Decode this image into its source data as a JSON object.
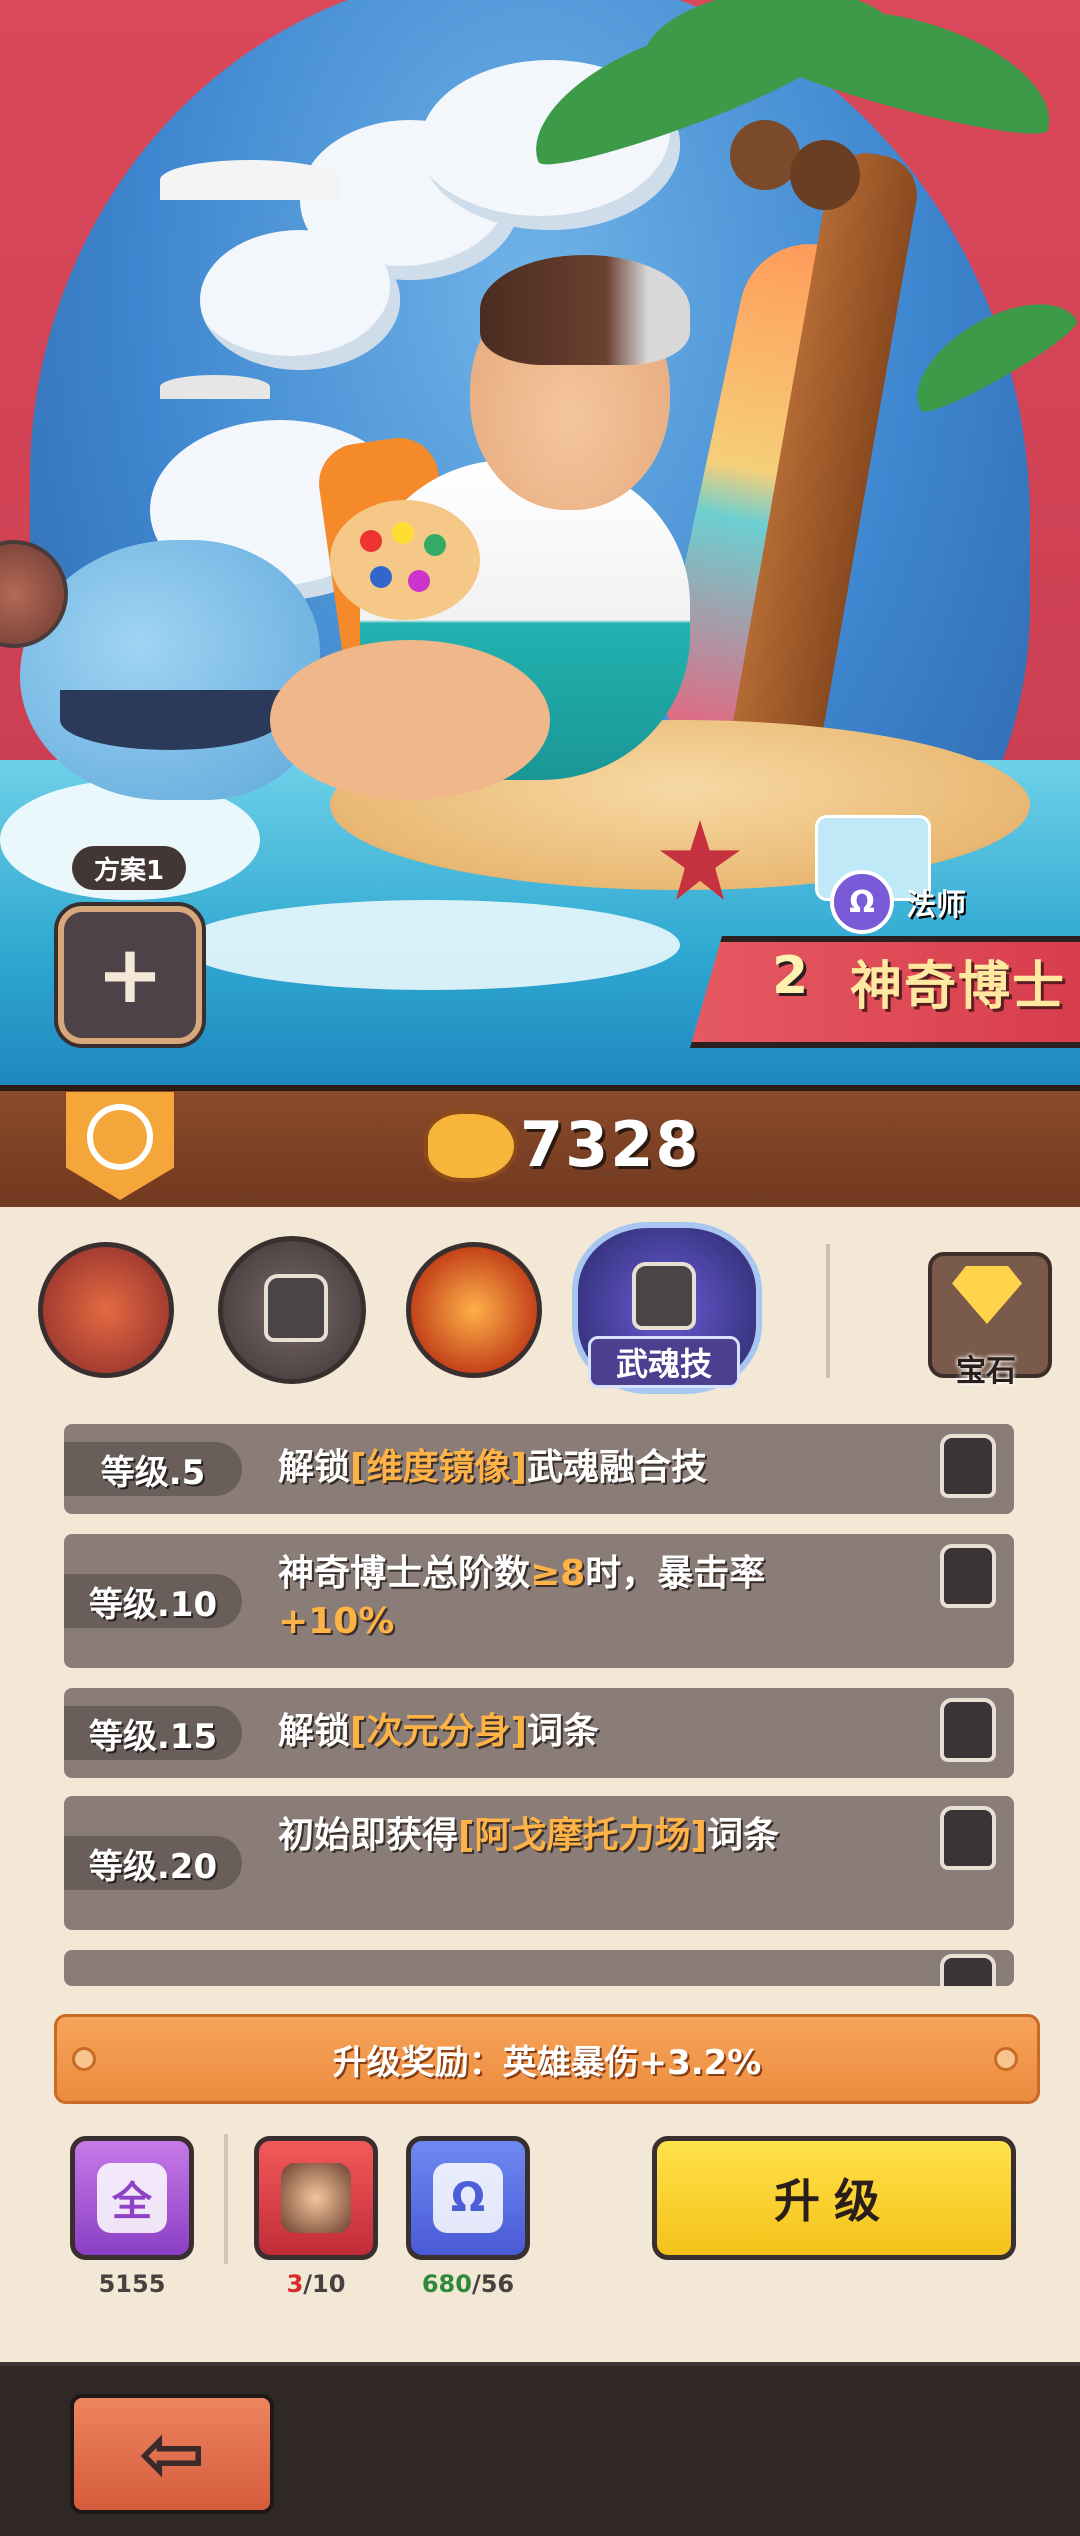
{
  "hero": {
    "plan_label": "方案1",
    "plan_add_icon": "+",
    "class_icon": "Ω",
    "class_name": "法师",
    "star_level": "2",
    "hero_name": "神奇博士"
  },
  "currency": {
    "amount": "7328"
  },
  "skills": {
    "wuhun_label": "武魂技",
    "gem_label": "宝石"
  },
  "levels": [
    {
      "level": "等级.5",
      "pre": "解锁",
      "hl": "[维度镜像]",
      "post": "武魂融合技"
    },
    {
      "level": "等级.10",
      "pre": "神奇博士总阶数",
      "hl": "≥8",
      "post": "时，暴击率",
      "hl2": "+10%"
    },
    {
      "level": "等级.15",
      "pre": "解锁",
      "hl": "[次元分身]",
      "post": "词条"
    },
    {
      "level": "等级.20",
      "pre": "初始即获得",
      "hl": "[阿戈摩托力场]",
      "post": "词条"
    }
  ],
  "reward": {
    "text": "升级奖励：英雄暴伤+3.2%"
  },
  "items": {
    "item1_icon": "全",
    "item1_count": "5155",
    "item2_have": "3",
    "item2_need": "/10",
    "item3_icon": "Ω",
    "item3_have": "680",
    "item3_need": "/56"
  },
  "buttons": {
    "upgrade": "升级"
  },
  "colors": {
    "highlight": "#ffb347",
    "upgrade_button": "#f4c21a",
    "reward_bar": "#ec8c3e"
  }
}
